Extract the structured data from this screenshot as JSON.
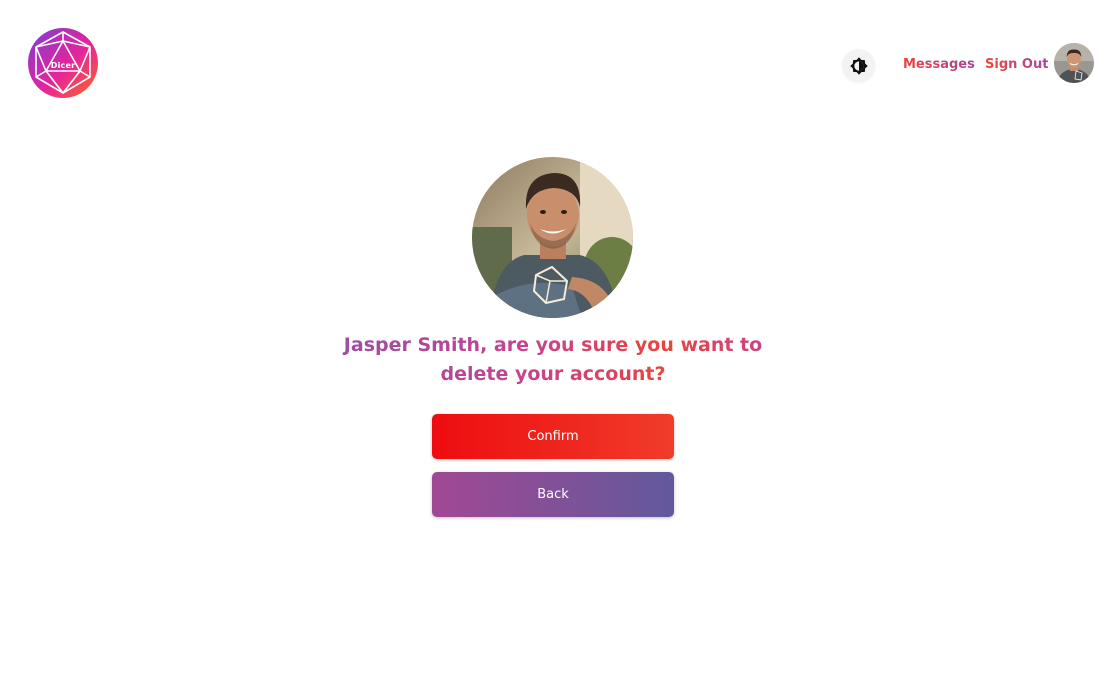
{
  "header": {
    "logo_text": "Dicer",
    "nav": {
      "messages_label": "Messages",
      "sign_out_label": "Sign Out"
    },
    "theme_toggle_icon": "brightness-icon"
  },
  "main": {
    "prompt": "Jasper Smith, are you sure you want to delete your account?",
    "confirm_label": "Confirm",
    "back_label": "Back"
  },
  "colors": {
    "confirm_start": "#ee0c10",
    "confirm_end": "#f03c2a",
    "back_start": "#a14893",
    "back_end": "#62599c",
    "logo_start": "#7a3fd6",
    "logo_mid": "#e6239b",
    "logo_end": "#ff6a1a"
  }
}
